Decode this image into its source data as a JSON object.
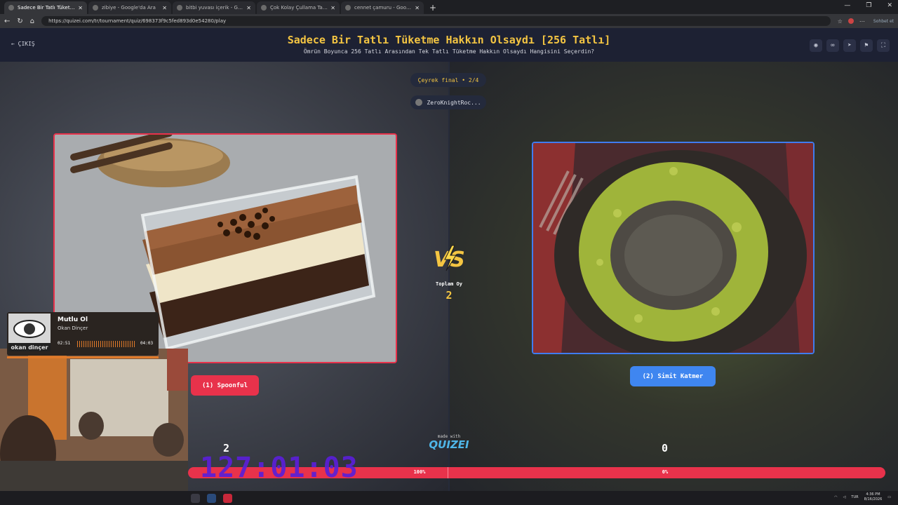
{
  "browser": {
    "tabs": [
      {
        "label": "Sadece Bir Tatlı Tüketme Hakkın O",
        "active": true
      },
      {
        "label": "zibiye - Google'da Ara",
        "active": false
      },
      {
        "label": "bitbi yuvası içerik - Google'da Ara",
        "active": false
      },
      {
        "label": "Çok Kolay Çullama Tatlısı - Nefis Y",
        "active": false
      },
      {
        "label": "cennet çamuru - Google'da Ara",
        "active": false
      }
    ],
    "new_tab": "+",
    "url": "https://quizei.com/tr/tournament/quiz/698373f9c5fed893d0e54280/play",
    "chat_button": "Sohbet et",
    "window_controls": [
      "—",
      "❐",
      "✕"
    ]
  },
  "header": {
    "exit_label": "ÇIKIŞ",
    "title": "Sadece Bir Tatlı Tüketme Hakkın Olsaydı [256 Tatlı]",
    "subtitle": "Ömrün Boyunca 256 Tatlı Arasından Tek Tatlı Tüketme Hakkın Olsaydı Hangisini Seçerdin?"
  },
  "round": {
    "stage": "Çeyrek final • 2/4",
    "player": "ZeroKnightRoc..."
  },
  "left": {
    "label": "(1) Spoonful",
    "votes": "2",
    "percent": "100%",
    "image": "chocolate-pudding-photo"
  },
  "right": {
    "label": "(2) Simit Katmer",
    "votes": "0",
    "percent": "0%",
    "image": "pistachio-katmer-photo"
  },
  "center": {
    "vs": "VS",
    "total_label": "Toplam Oy",
    "total_value": "2",
    "made_with": "made with",
    "logo": "QUIZEI"
  },
  "overlay": {
    "timer": "127:01:03"
  },
  "music": {
    "title": "Mutlu Ol",
    "artist": "Okan Dinçer",
    "elapsed": "02:51",
    "duration": "04:03",
    "album_text": "okan dinçer"
  },
  "taskbar": {
    "lang": "TUR",
    "time": "4:36 PM",
    "date": "8/16/2026"
  },
  "colors": {
    "accent_gold": "#f4c542",
    "left_red": "#e8324b",
    "right_blue": "#3f86f0",
    "timer_purple": "#5a1fd8"
  },
  "vote_share": {
    "left": 1.0,
    "right": 0.0
  }
}
